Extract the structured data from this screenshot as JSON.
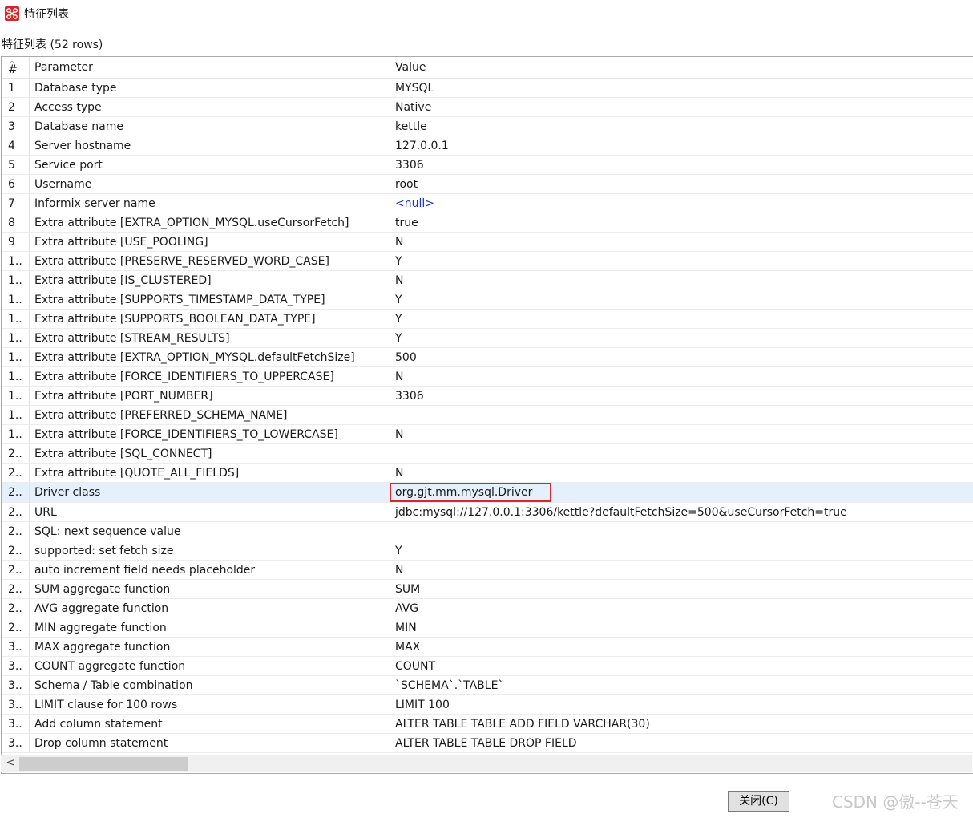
{
  "window": {
    "title": "特征列表",
    "icon": "app-logo-icon"
  },
  "caption": "特征列表 (52 rows)",
  "table": {
    "columns": [
      "#",
      "Parameter",
      "Value"
    ],
    "rows": [
      {
        "num": "1",
        "param": "Database type",
        "value": "MYSQL"
      },
      {
        "num": "2",
        "param": "Access type",
        "value": "Native"
      },
      {
        "num": "3",
        "param": "Database name",
        "value": "kettle"
      },
      {
        "num": "4",
        "param": "Server hostname",
        "value": "127.0.0.1"
      },
      {
        "num": "5",
        "param": "Service port",
        "value": "3306"
      },
      {
        "num": "6",
        "param": "Username",
        "value": "root"
      },
      {
        "num": "7",
        "param": "Informix server name",
        "value": "<null>"
      },
      {
        "num": "8",
        "param": "Extra attribute [EXTRA_OPTION_MYSQL.useCursorFetch]",
        "value": "true"
      },
      {
        "num": "9",
        "param": "Extra attribute [USE_POOLING]",
        "value": "N"
      },
      {
        "num": "1..",
        "param": "Extra attribute [PRESERVE_RESERVED_WORD_CASE]",
        "value": "Y"
      },
      {
        "num": "1..",
        "param": "Extra attribute [IS_CLUSTERED]",
        "value": "N"
      },
      {
        "num": "1..",
        "param": "Extra attribute [SUPPORTS_TIMESTAMP_DATA_TYPE]",
        "value": "Y"
      },
      {
        "num": "1..",
        "param": "Extra attribute [SUPPORTS_BOOLEAN_DATA_TYPE]",
        "value": "Y"
      },
      {
        "num": "1..",
        "param": "Extra attribute [STREAM_RESULTS]",
        "value": "Y"
      },
      {
        "num": "1..",
        "param": "Extra attribute [EXTRA_OPTION_MYSQL.defaultFetchSize]",
        "value": "500"
      },
      {
        "num": "1..",
        "param": "Extra attribute [FORCE_IDENTIFIERS_TO_UPPERCASE]",
        "value": "N"
      },
      {
        "num": "1..",
        "param": "Extra attribute [PORT_NUMBER]",
        "value": "3306"
      },
      {
        "num": "1..",
        "param": "Extra attribute [PREFERRED_SCHEMA_NAME]",
        "value": ""
      },
      {
        "num": "1..",
        "param": "Extra attribute [FORCE_IDENTIFIERS_TO_LOWERCASE]",
        "value": "N"
      },
      {
        "num": "2..",
        "param": "Extra attribute [SQL_CONNECT]",
        "value": ""
      },
      {
        "num": "2..",
        "param": "Extra attribute [QUOTE_ALL_FIELDS]",
        "value": "N"
      },
      {
        "num": "2..",
        "param": "Driver class",
        "value": "org.gjt.mm.mysql.Driver"
      },
      {
        "num": "2..",
        "param": "URL",
        "value": "jdbc:mysql://127.0.0.1:3306/kettle?defaultFetchSize=500&useCursorFetch=true"
      },
      {
        "num": "2..",
        "param": "SQL: next sequence value",
        "value": ""
      },
      {
        "num": "2..",
        "param": "supported: set fetch size",
        "value": "Y"
      },
      {
        "num": "2..",
        "param": "auto increment field needs placeholder",
        "value": "N"
      },
      {
        "num": "2..",
        "param": "SUM aggregate function",
        "value": "SUM"
      },
      {
        "num": "2..",
        "param": "AVG aggregate function",
        "value": "AVG"
      },
      {
        "num": "2..",
        "param": "MIN aggregate function",
        "value": "MIN"
      },
      {
        "num": "3..",
        "param": "MAX aggregate function",
        "value": "MAX"
      },
      {
        "num": "3..",
        "param": "COUNT aggregate function",
        "value": "COUNT"
      },
      {
        "num": "3..",
        "param": "Schema / Table combination",
        "value": "`SCHEMA`.`TABLE`"
      },
      {
        "num": "3..",
        "param": "LIMIT clause for 100 rows",
        "value": " LIMIT 100"
      },
      {
        "num": "3..",
        "param": "Add column statement",
        "value": "ALTER TABLE TABLE ADD FIELD VARCHAR(30)"
      },
      {
        "num": "3..",
        "param": "Drop column statement",
        "value": "ALTER TABLE TABLE DROP FIELD"
      }
    ],
    "selected_row_index": 21,
    "highlighted_value": "org.gjt.mm.mysql.Driver"
  },
  "buttons": {
    "close_label": "关闭(C)"
  },
  "watermark": "CSDN @傲--苍天",
  "colors": {
    "null_text": "#1b35c7",
    "selected_row": "#e4f0fb",
    "highlight_border": "#d9262b",
    "app_icon": "#d7262a"
  }
}
